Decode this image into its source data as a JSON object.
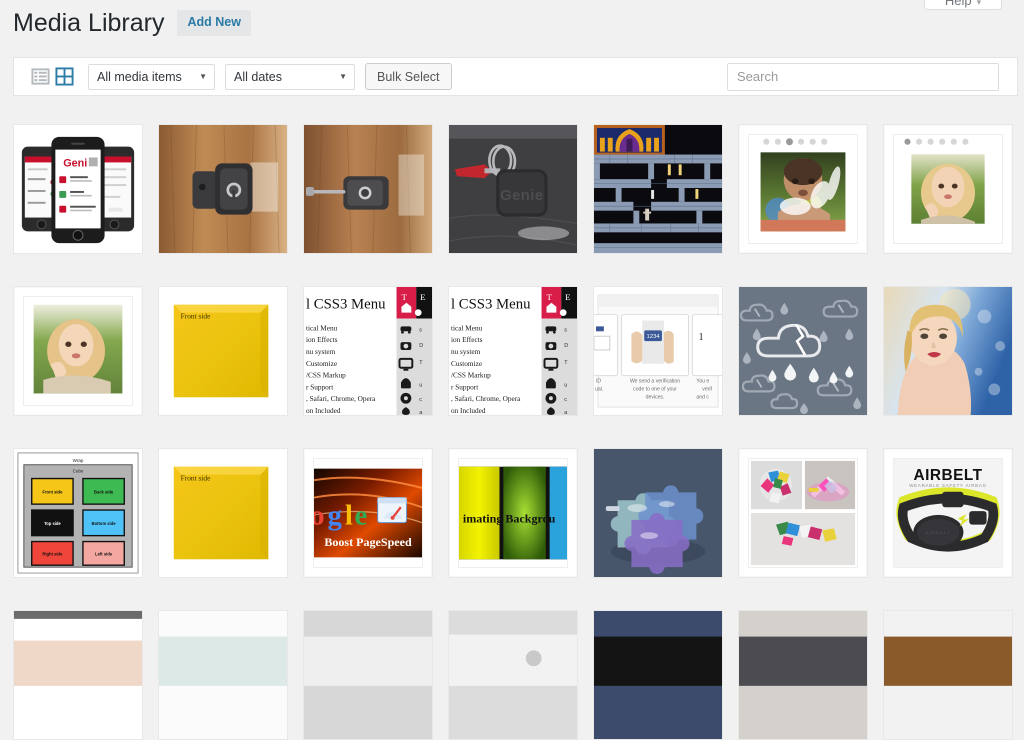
{
  "help_tab": {
    "label": "Help",
    "caret": "▾"
  },
  "header": {
    "title": "Media Library",
    "add_new_label": "Add New"
  },
  "toolbar": {
    "list_view_icon": "list-view-icon",
    "grid_view_icon": "grid-view-icon",
    "active_view": "grid",
    "media_filter": {
      "value": "All media items",
      "caret": "▼"
    },
    "date_filter": {
      "value": "All dates",
      "caret": "▼"
    },
    "bulk_select_label": "Bulk Select",
    "search": {
      "value": "",
      "placeholder": "Search"
    }
  },
  "colors": {
    "page_bg": "#f1f1f1",
    "panel_bg": "#ffffff",
    "link_blue": "#2a7aa5",
    "active_icon_blue": "#2e7ca8",
    "inactive_icon_gray": "#b4b9be",
    "title_text": "#23282d",
    "border": "#e2e4e7"
  },
  "grid": {
    "columns": 7,
    "items": [
      {
        "name": "genie-app-phone-mockup",
        "alt": "Three iPhones showing Genie smart-lock app with Home, Work and John Appleseed entries"
      },
      {
        "name": "genie-lock-on-wood-door",
        "alt": "Black Genie smart lock mounted on a wooden door"
      },
      {
        "name": "genie-lock-with-key",
        "alt": "Black Genie lock with key inserted on wooden door"
      },
      {
        "name": "genie-keyfob-red-key",
        "alt": "Genie black key fob with red key on dark slate surface"
      },
      {
        "name": "prince-of-persia-game",
        "alt": "Retro pixel platform game level with ornate purple throne room"
      },
      {
        "name": "baby-splashing-water",
        "alt": "Photo slider showing baby splashing water, with dot navigation"
      },
      {
        "name": "blonde-girl-portrait-1",
        "alt": "Photo slider showing blonde girl resting chin on hand, with dot navigation"
      },
      {
        "name": "blonde-girl-portrait-2",
        "alt": "Blonde girl portrait in white frame"
      },
      {
        "name": "yellow-sticky-note-front",
        "alt": "Yellow sticky note labelled Front side"
      },
      {
        "name": "css3-menu-demo-1",
        "alt": "Vertical CSS3 Menu demo screenshot with feature list and icon column"
      },
      {
        "name": "css3-menu-demo-2",
        "alt": "Vertical CSS3 Menu demo screenshot, second variant"
      },
      {
        "name": "two-factor-verification",
        "alt": "Two-factor authentication steps: We send a verification code to one of your devices"
      },
      {
        "name": "rain-clouds-pattern",
        "alt": "Grey pattern of cracked clouds and raindrops"
      },
      {
        "name": "blonde-woman-portrait",
        "alt": "Blonde woman portrait against blue bokeh background"
      },
      {
        "name": "css-cube-faces-diagram",
        "alt": "CSS 3D cube diagram with Wrap and Cube labels and six coloured faces: front side, back side, top side, bottom side, right side, left side"
      },
      {
        "name": "yellow-sticky-note-front-2",
        "alt": "Yellow sticky note labelled Front side"
      },
      {
        "name": "google-boost-pagespeed",
        "alt": "Google logo with speedometer icon and caption Boost PageSpeed"
      },
      {
        "name": "animating-background",
        "alt": "Yellow green and blue gradient panels with text Animating Background"
      },
      {
        "name": "blue-puzzle-pieces",
        "alt": "Translucent blue and purple puzzle pieces on grey background"
      },
      {
        "name": "colored-puzzle-collage",
        "alt": "Collage of three photos of small coloured foam puzzle pieces"
      },
      {
        "name": "airbelt-safety-airbag",
        "alt": "AIRBELT wearable safety airbag product photo, yellow and black belt"
      },
      {
        "name": "partial-row-item-1",
        "alt": "Partially visible thumbnail in next row"
      },
      {
        "name": "partial-row-item-2",
        "alt": "Partially visible thumbnail in next row"
      },
      {
        "name": "partial-row-item-3",
        "alt": "Partially visible thumbnail in next row"
      },
      {
        "name": "partial-row-item-4",
        "alt": "Partially visible thumbnail in next row"
      },
      {
        "name": "partial-row-item-5",
        "alt": "Partially visible thumbnail in next row"
      },
      {
        "name": "partial-row-item-6",
        "alt": "Partially visible thumbnail in next row"
      },
      {
        "name": "partial-row-item-7",
        "alt": "Partially visible thumbnail in next row"
      }
    ]
  },
  "thumbnail_text": {
    "genie_app_logo": "Genie",
    "genie_app_rows": [
      "Home",
      "Work",
      "John Appleseed"
    ],
    "genie_fob_logo": "Genie",
    "css3_menu_title": "l CSS3 Menu",
    "css3_menu_lines": [
      "tical Menu",
      "ion Effects",
      "nu system",
      "Customize",
      "/CSS Markup",
      "r Support",
      ", Safari, Chrome, Opera",
      "on Included"
    ],
    "two_factor_caption": "We send a verification code to one of your devices.",
    "two_factor_left": "ID ual.",
    "two_factor_right": "You e verif and c",
    "two_factor_code": "1234",
    "sticky_note_label": "Front side",
    "cube_wrap_label": "Wrap",
    "cube_label": "Cube",
    "cube_faces": [
      "Front side",
      "Back side",
      "Top side",
      "Bottom side",
      "Right side",
      "Left side"
    ],
    "pagespeed_caption": "Boost PageSpeed",
    "animating_caption": "imating Backgrou",
    "airbelt_title": "AIRBELT",
    "airbelt_subtitle": "WEARABLE SAFETY AIRBAG",
    "airbelt_device_label": "AIRBELT"
  }
}
